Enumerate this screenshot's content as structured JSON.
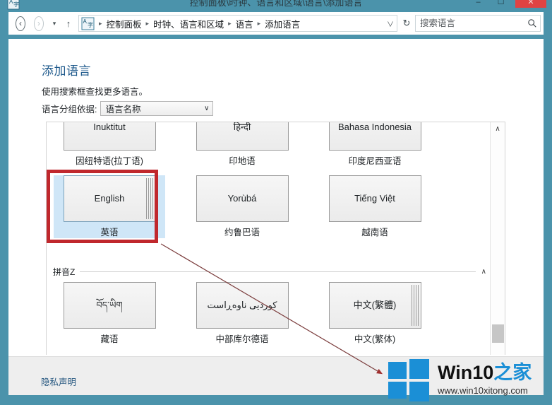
{
  "window": {
    "title": "控制面板\\时钟、语言和区域\\语言\\添加语言",
    "icon": "language-icon",
    "minimize_label": "–",
    "maximize_label": "☐",
    "close_label": "✕",
    "frame_color": "#4b93ab",
    "close_color": "#e04343"
  },
  "navbar": {
    "back_label": "‹",
    "forward_label": "›",
    "recent_label": "▾",
    "up_label": "↑",
    "breadcrumb": [
      "控制面板",
      "时钟、语言和区域",
      "语言",
      "添加语言"
    ],
    "breadcrumb_separator": "▸",
    "breadcrumb_dropdown_label": "∨",
    "refresh_label": "↻",
    "search_placeholder": "搜索语言",
    "search_value": "",
    "search_icon": "magnifier-icon"
  },
  "page": {
    "title": "添加语言",
    "subtitle": "使用搜索框查找更多语言。",
    "groupby_label": "语言分组依据:",
    "groupby_value": "语言名称",
    "groupby_caret": "∨"
  },
  "groups": [
    {
      "header": "",
      "rows": [
        [
          {
            "native": "Inuktitut",
            "label": "因纽特语(拉丁语)",
            "stacked": false,
            "selected": false
          },
          {
            "native": "हिन्दी",
            "label": "印地语",
            "stacked": false,
            "selected": false
          },
          {
            "native": "Bahasa Indonesia",
            "label": "印度尼西亚语",
            "stacked": false,
            "selected": false
          }
        ],
        [
          {
            "native": "English",
            "label": "英语",
            "stacked": true,
            "selected": true
          },
          {
            "native": "Yorùbá",
            "label": "约鲁巴语",
            "stacked": false,
            "selected": false
          },
          {
            "native": "Tiếng Việt",
            "label": "越南语",
            "stacked": false,
            "selected": false
          }
        ]
      ]
    },
    {
      "header": "拼音Z",
      "header_caret": "∧",
      "rows": [
        [
          {
            "native": "བོད་ཡིག",
            "label": "藏语",
            "stacked": false,
            "selected": false
          },
          {
            "native": "کوردیی ناوەڕاست",
            "label": "中部库尔德语",
            "stacked": false,
            "selected": false
          },
          {
            "native": "中文(繁體)",
            "label": "中文(繁体)",
            "stacked": true,
            "selected": false
          }
        ]
      ]
    }
  ],
  "scrollbar": {
    "up_arrow": "∧",
    "position": "bottom"
  },
  "footer": {
    "privacy_link": "隐私声明"
  },
  "annotation": {
    "box_color": "#c0282d",
    "arrow_color": "#a0302f",
    "target": "english-language-tile"
  },
  "watermark": {
    "title_en": "Win10",
    "title_cn": "之家",
    "url": "www.win10xitong.com",
    "logo_color": "#1b8fd6"
  }
}
